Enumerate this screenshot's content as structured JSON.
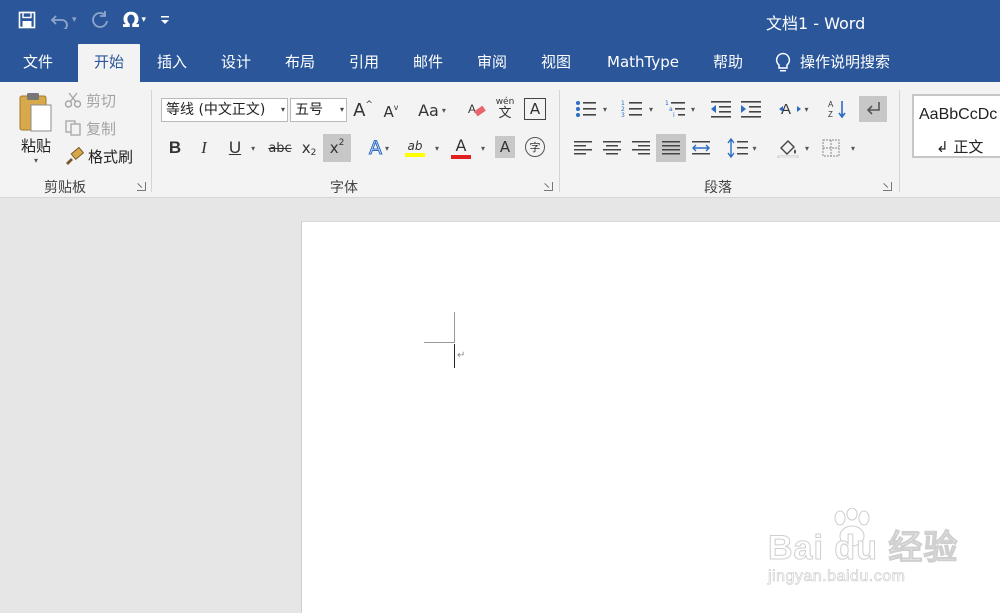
{
  "window": {
    "title": "文档1  -  Word"
  },
  "quick_access": {
    "save": "save-icon",
    "undo": "undo-icon",
    "redo": "redo-icon",
    "symbol": "Ω",
    "customize": "customize-qat-icon"
  },
  "tabs": [
    {
      "label": "文件",
      "active": false
    },
    {
      "label": "开始",
      "active": true
    },
    {
      "label": "插入",
      "active": false
    },
    {
      "label": "设计",
      "active": false
    },
    {
      "label": "布局",
      "active": false
    },
    {
      "label": "引用",
      "active": false
    },
    {
      "label": "邮件",
      "active": false
    },
    {
      "label": "审阅",
      "active": false
    },
    {
      "label": "视图",
      "active": false
    },
    {
      "label": "MathType",
      "active": false
    },
    {
      "label": "帮助",
      "active": false
    }
  ],
  "tell_me": {
    "label": "操作说明搜索"
  },
  "clipboard": {
    "group_label": "剪贴板",
    "paste": "粘贴",
    "cut": "剪切",
    "copy": "复制",
    "format_painter": "格式刷"
  },
  "font": {
    "group_label": "字体",
    "font_name": "等线 (中文正文)",
    "font_size": "五号",
    "grow": "A",
    "shrink": "A",
    "change_case": "Aa",
    "phonetic_top": "wén",
    "phonetic_bottom": "文",
    "char_border": "A",
    "bold": "B",
    "italic": "I",
    "underline": "U",
    "strikethrough": "abc",
    "subscript": "x",
    "subscript_mark": "2",
    "superscript": "x",
    "superscript_mark": "2",
    "text_effects": "A",
    "highlight": "ab",
    "font_color": "A",
    "char_shading": "A",
    "enclose": "字"
  },
  "paragraph": {
    "group_label": "段落"
  },
  "styles": {
    "sample": "AaBbCcDc",
    "name": "↲ 正文"
  },
  "document": {
    "paragraph_mark": "↵"
  },
  "watermark": {
    "brand": "Bai du 经验",
    "url": "jingyan.baidu.com"
  },
  "colors": {
    "accent": "#2b579a",
    "highlight": "#ffff00",
    "font_color": "#e02020"
  }
}
